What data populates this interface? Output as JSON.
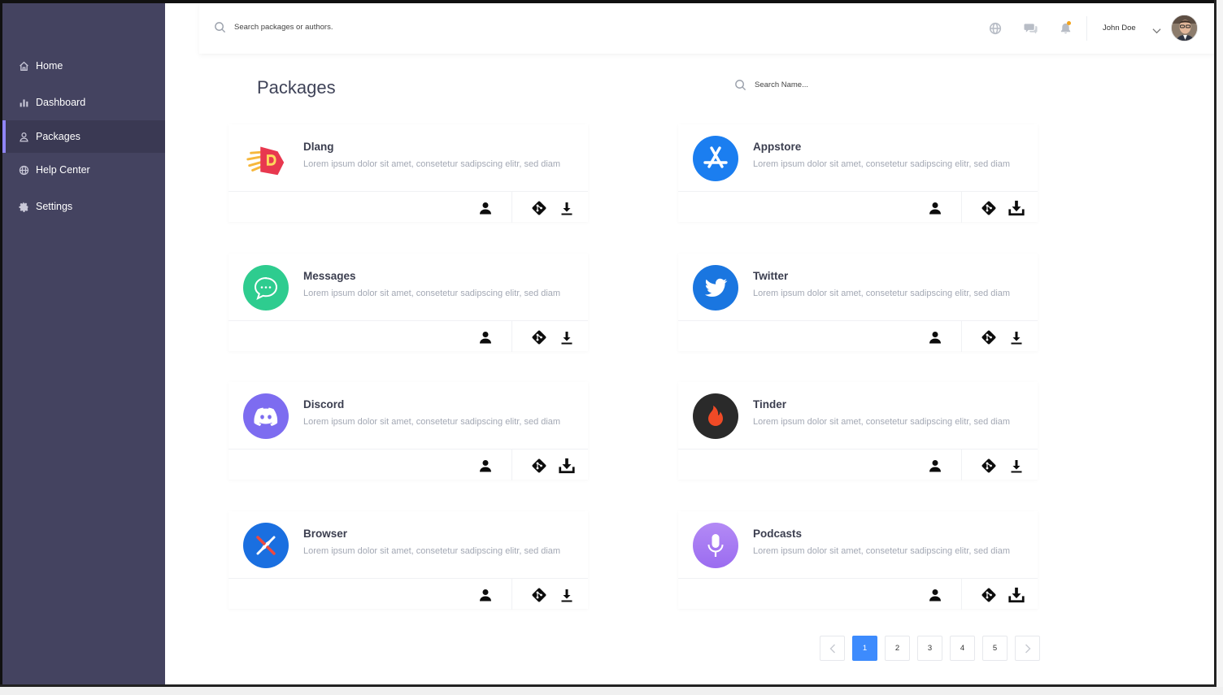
{
  "sidebar": {
    "items": [
      {
        "label": "Home",
        "icon": "home-icon"
      },
      {
        "label": "Dashboard",
        "icon": "bar-chart-icon"
      },
      {
        "label": "Packages",
        "icon": "user-icon",
        "active": true
      },
      {
        "label": "Help Center",
        "icon": "globe-icon"
      },
      {
        "label": "Settings",
        "icon": "gear-icon"
      }
    ],
    "accent": "#8f85f5",
    "background": "#444360"
  },
  "topbar": {
    "search_placeholder": "Search packages or authors.",
    "icons": [
      "globe-icon",
      "chat-icon",
      "bell-icon"
    ],
    "notification_dot_color": "#f3a31b",
    "user_name": "John Doe"
  },
  "page": {
    "title": "Packages",
    "name_search_placeholder": "Search Name..."
  },
  "packages": [
    {
      "name": "Dlang",
      "description": "Lorem ipsum dolor sit amet, consetetur sadipscing elitr, sed diam",
      "logo": "dlang-logo",
      "color": "#e8384f"
    },
    {
      "name": "Appstore",
      "description": "Lorem ipsum dolor sit amet, consetetur sadipscing elitr, sed diam",
      "logo": "appstore-logo",
      "color": "#1b7ef0"
    },
    {
      "name": "Messages",
      "description": "Lorem ipsum dolor sit amet, consetetur sadipscing elitr, sed diam",
      "logo": "messages-logo",
      "color": "#2ecc8f"
    },
    {
      "name": "Twitter",
      "description": "Lorem ipsum dolor sit amet, consetetur sadipscing elitr, sed diam",
      "logo": "twitter-logo",
      "color": "#1a76e0"
    },
    {
      "name": "Discord",
      "description": "Lorem ipsum dolor sit amet, consetetur sadipscing elitr, sed diam",
      "logo": "discord-logo",
      "color": "#7d6cf0"
    },
    {
      "name": "Tinder",
      "description": "Lorem ipsum dolor sit amet, consetetur sadipscing elitr, sed diam",
      "logo": "tinder-logo",
      "color": "#2a2a2a"
    },
    {
      "name": "Browser",
      "description": "Lorem ipsum dolor sit amet, consetetur sadipscing elitr, sed diam",
      "logo": "browser-logo",
      "color": "#1a6fe0"
    },
    {
      "name": "Podcasts",
      "description": "Lorem ipsum dolor sit amet, consetetur sadipscing elitr, sed diam",
      "logo": "podcasts-logo",
      "color": "#9b6cf0"
    }
  ],
  "card_actions": [
    "author-icon",
    "git-icon",
    "download-icon"
  ],
  "pagination": {
    "pages": [
      "1",
      "2",
      "3",
      "4",
      "5"
    ],
    "current": "1",
    "accent": "#3d8bfd"
  }
}
